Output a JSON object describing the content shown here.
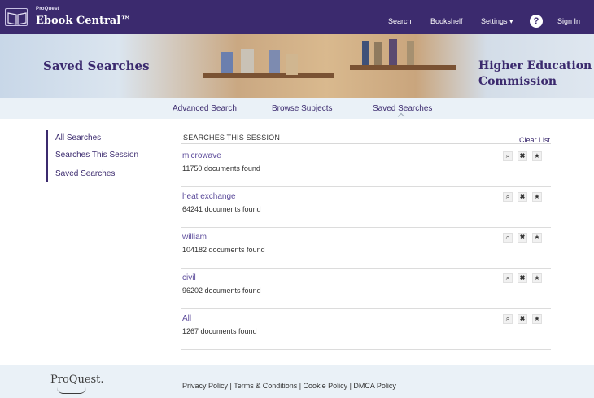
{
  "header": {
    "brand_small": "ProQuest",
    "brand_main": "Ebook Central™",
    "nav": {
      "search": "Search",
      "bookshelf": "Bookshelf",
      "settings": "Settings ▾",
      "help": "?",
      "sign_in": "Sign In"
    }
  },
  "banner": {
    "title": "Saved Searches",
    "institution": "Higher Education Commission"
  },
  "subnav": {
    "tabs": [
      {
        "label": "Advanced Search"
      },
      {
        "label": "Browse Subjects"
      },
      {
        "label": "Saved Searches"
      }
    ]
  },
  "sidebar": {
    "items": [
      {
        "label": "All Searches"
      },
      {
        "label": "Searches This Session"
      },
      {
        "label": "Saved Searches"
      }
    ]
  },
  "main": {
    "section_title": "SEARCHES THIS SESSION",
    "clear_list": "Clear List",
    "searches": [
      {
        "name": "microwave",
        "count": "11750 documents found"
      },
      {
        "name": "heat exchange",
        "count": "64241 documents found"
      },
      {
        "name": "william",
        "count": "104182 documents found"
      },
      {
        "name": "civil",
        "count": "96202 documents found"
      },
      {
        "name": "All",
        "count": "1267 documents found"
      }
    ],
    "actions": {
      "search_icon": "⌕",
      "delete_icon": "✖",
      "save_icon": "★"
    }
  },
  "footer": {
    "logo": "ProQuest.",
    "links": "Privacy Policy | Terms & Conditions | Cookie Policy | DMCA Policy"
  },
  "colors": {
    "brand_purple": "#3b2a6e",
    "link_purple": "#5b4a9a",
    "subnav_bg": "#eaf1f7"
  }
}
